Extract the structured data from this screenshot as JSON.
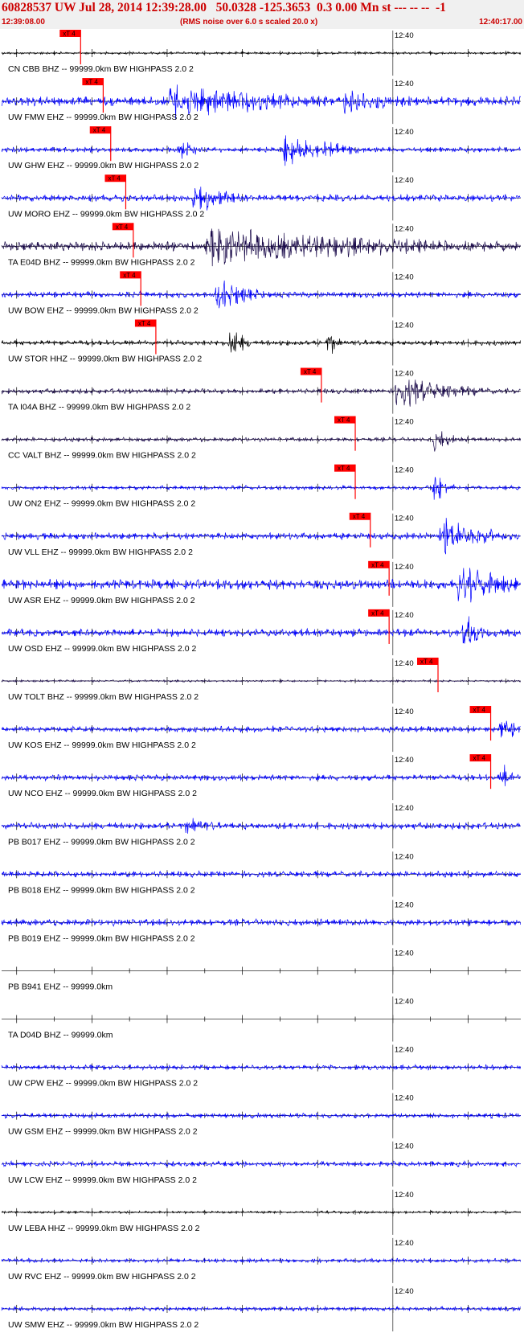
{
  "header": {
    "title": "60828537 UW Jul 28, 2014 12:39:28.00   50.0328 -125.3653  0.3 0.00 Mn st --- -- --  -1",
    "start_time": "12:39:08.00",
    "noise_note": "(RMS noise over 6.0 s scaled 20.0 x)",
    "end_time": "12:40:17.00"
  },
  "colors": {
    "header_text": "#cc0000",
    "trace_blue": "#0000ff",
    "trace_dark": "#1a0a4a",
    "trace_black": "#000000",
    "pick": "#ff0000",
    "axis": "#000000"
  },
  "chart_data": {
    "type": "line",
    "title": "60828537 UW Jul 28, 2014 12:39:28.00   50.0328 -125.3653  0.3 0.00 Mn st --- -- --  -1",
    "x_range": [
      "12:39:08.00",
      "12:40:17.00"
    ],
    "x_tick_label": "12:40",
    "pick_label": "xT 4",
    "series": [
      {
        "label": "CN CBB BHZ -- 99999.0km BW  HIGHPASS  2.0  2",
        "color": "#000000",
        "amp": 0.06,
        "pick": "12:39:18.5",
        "bursts": []
      },
      {
        "label": "UW FMW EHZ -- 99999.0km BW  HIGHPASS  2.0  2",
        "color": "#0000ff",
        "amp": 0.22,
        "pick": "12:39:21.5",
        "bursts": [
          {
            "t": 22,
            "d": 30,
            "a": 0.95
          },
          {
            "t": 45,
            "d": 20,
            "a": 0.6
          }
        ]
      },
      {
        "label": "UW GHW EHZ -- 99999.0km BW  HIGHPASS  2.0  2",
        "color": "#0000ff",
        "amp": 0.12,
        "pick": "12:39:22.5",
        "bursts": [
          {
            "t": 23,
            "d": 4,
            "a": 0.7
          },
          {
            "t": 37,
            "d": 14,
            "a": 0.8
          }
        ]
      },
      {
        "label": "UW MORO EHZ -- 99999.0km BW  HIGHPASS  2.0  2",
        "color": "#0000ff",
        "amp": 0.16,
        "pick": "12:39:24.5",
        "bursts": [
          {
            "t": 25,
            "d": 10,
            "a": 0.8
          }
        ]
      },
      {
        "label": "TA E04D BHZ -- 99999.0km BW  HIGHPASS  2.0  2",
        "color": "#1a0a4a",
        "amp": 0.22,
        "pick": "12:39:25.5",
        "bursts": [
          {
            "t": 27,
            "d": 50,
            "a": 1.0
          }
        ]
      },
      {
        "label": "UW BOW EHZ -- 99999.0km BW  HIGHPASS  2.0  2",
        "color": "#0000ff",
        "amp": 0.14,
        "pick": "12:39:26.5",
        "bursts": [
          {
            "t": 28,
            "d": 8,
            "a": 0.95
          }
        ]
      },
      {
        "label": "UW STOR HHZ -- 99999.0km BW  HIGHPASS  2.0  2",
        "color": "#000000",
        "amp": 0.12,
        "pick": "12:39:28.5",
        "bursts": [
          {
            "t": 30,
            "d": 3,
            "a": 0.95
          },
          {
            "t": 43,
            "d": 2,
            "a": 0.8
          }
        ]
      },
      {
        "label": "TA I04A BHZ -- 99999.0km BW  HIGHPASS  2.0  2",
        "color": "#1a0a4a",
        "amp": 0.12,
        "pick": "12:39:50.5",
        "bursts": [
          {
            "t": 52,
            "d": 14,
            "a": 0.9
          }
        ]
      },
      {
        "label": "CC VALT BHZ -- 99999.0km BW  HIGHPASS  2.0  2",
        "color": "#1a0a4a",
        "amp": 0.1,
        "pick": "12:39:55.0",
        "bursts": [
          {
            "t": 57,
            "d": 5,
            "a": 0.6
          }
        ]
      },
      {
        "label": "UW ON2 EHZ -- 99999.0km BW  HIGHPASS  2.0  2",
        "color": "#0000ff",
        "amp": 0.1,
        "pick": "12:39:55.0",
        "bursts": [
          {
            "t": 57,
            "d": 3,
            "a": 0.9
          }
        ]
      },
      {
        "label": "UW VLL EHZ -- 99999.0km BW  HIGHPASS  2.0  2",
        "color": "#0000ff",
        "amp": 0.16,
        "pick": "12:39:57.0",
        "bursts": [
          {
            "t": 58,
            "d": 12,
            "a": 0.95
          }
        ]
      },
      {
        "label": "UW ASR EHZ -- 99999.0km BW  HIGHPASS  2.0  2",
        "color": "#0000ff",
        "amp": 0.24,
        "pick": "12:39:59.5",
        "bursts": [
          {
            "t": 60,
            "d": 16,
            "a": 1.0
          }
        ]
      },
      {
        "label": "UW OSD EHZ -- 99999.0km BW  HIGHPASS  2.0  2",
        "color": "#0000ff",
        "amp": 0.18,
        "pick": "12:39:59.5",
        "bursts": [
          {
            "t": 61,
            "d": 4,
            "a": 1.0
          }
        ]
      },
      {
        "label": "UW TOLT BHZ -- 99999.0km BW  HIGHPASS  2.0  2",
        "color": "#1a0a4a",
        "amp": 0.05,
        "pick": "12:40:06.0",
        "bursts": []
      },
      {
        "label": "UW KOS EHZ -- 99999.0km BW  HIGHPASS  2.0  2",
        "color": "#0000ff",
        "amp": 0.14,
        "pick": "12:40:13.0",
        "bursts": [
          {
            "t": 66,
            "d": 3,
            "a": 0.9
          }
        ]
      },
      {
        "label": "UW NCO EHZ -- 99999.0km BW  HIGHPASS  2.0  2",
        "color": "#0000ff",
        "amp": 0.14,
        "pick": "12:40:13.0",
        "bursts": [
          {
            "t": 66,
            "d": 2,
            "a": 0.8
          }
        ]
      },
      {
        "label": "PB B017 EHZ -- 99999.0km BW  HIGHPASS  2.0  2",
        "color": "#0000ff",
        "amp": 0.16,
        "pick": null,
        "bursts": [
          {
            "t": 24,
            "d": 8,
            "a": 0.5
          }
        ]
      },
      {
        "label": "PB B018 EHZ -- 99999.0km BW  HIGHPASS  2.0  2",
        "color": "#0000ff",
        "amp": 0.14,
        "pick": null,
        "bursts": []
      },
      {
        "label": "PB B019 EHZ -- 99999.0km BW  HIGHPASS  2.0  2",
        "color": "#0000ff",
        "amp": 0.16,
        "pick": null,
        "bursts": []
      },
      {
        "label": "PB B941 EHZ -- 99999.0km",
        "color": "#0000ff",
        "amp": 0.0,
        "pick": null,
        "bursts": []
      },
      {
        "label": "TA D04D BHZ -- 99999.0km",
        "color": "#1a0a4a",
        "amp": 0.0,
        "pick": null,
        "bursts": []
      },
      {
        "label": "UW CPW EHZ -- 99999.0km BW  HIGHPASS  2.0  2",
        "color": "#0000ff",
        "amp": 0.12,
        "pick": null,
        "bursts": []
      },
      {
        "label": "UW GSM EHZ -- 99999.0km BW  HIGHPASS  2.0  2",
        "color": "#0000ff",
        "amp": 0.12,
        "pick": null,
        "bursts": []
      },
      {
        "label": "UW LCW EHZ -- 99999.0km BW  HIGHPASS  2.0  2",
        "color": "#0000ff",
        "amp": 0.12,
        "pick": null,
        "bursts": []
      },
      {
        "label": "UW LEBA HHZ -- 99999.0km BW  HIGHPASS  2.0  2",
        "color": "#000000",
        "amp": 0.06,
        "pick": null,
        "bursts": []
      },
      {
        "label": "UW RVC EHZ -- 99999.0km BW  HIGHPASS  2.0  2",
        "color": "#0000ff",
        "amp": 0.1,
        "pick": null,
        "bursts": []
      },
      {
        "label": "UW SMW EHZ -- 99999.0km BW  HIGHPASS  2.0  2",
        "color": "#0000ff",
        "amp": 0.1,
        "pick": null,
        "bursts": []
      }
    ]
  }
}
